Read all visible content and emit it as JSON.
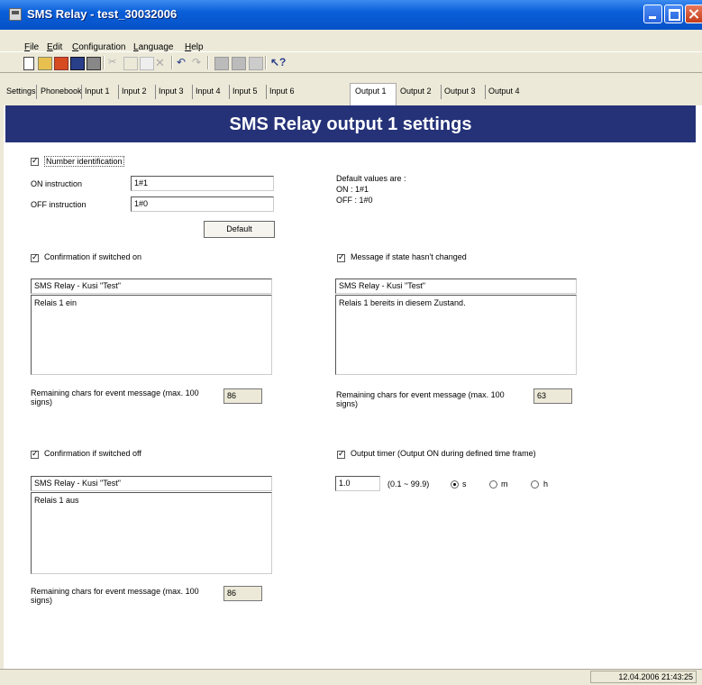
{
  "window": {
    "title": "SMS Relay - test_30032006"
  },
  "menu": [
    "File",
    "Edit",
    "Configuration",
    "Language",
    "Help"
  ],
  "toolbar": {
    "icons": [
      "new-icon",
      "open-icon",
      "open-folder-icon",
      "save-icon",
      "print-icon",
      "cut-icon",
      "copy-icon",
      "paste-icon",
      "delete-icon",
      "undo-icon",
      "redo-icon",
      "read-device-icon",
      "write-device-icon",
      "device-icon",
      "help-pointer-icon"
    ]
  },
  "tabs": [
    "Settings",
    "Phonebook",
    "Input 1",
    "Input 2",
    "Input 3",
    "Input 4",
    "Input 5",
    "Input 6",
    "Output 1",
    "Output 2",
    "Output 3",
    "Output 4"
  ],
  "active_tab": "Output 1",
  "header": {
    "title": "SMS Relay output 1 settings"
  },
  "number_identification": {
    "label": "Number identification",
    "checked": true,
    "on_label": "ON instruction",
    "on_value": "1#1",
    "off_label": "OFF instruction",
    "off_value": "1#0",
    "default_button": "Default"
  },
  "defaults_info": {
    "heading": "Default values are :",
    "on": "ON : 1#1",
    "off": "OFF : 1#0"
  },
  "confirm_on": {
    "label": "Confirmation if switched on",
    "checked": true,
    "sender": "SMS Relay - Kusi \"Test\"",
    "message": "Relais 1 ein",
    "remaining_label": "Remaining chars for event message (max. 100 signs)",
    "remaining_value": "86"
  },
  "unchanged": {
    "label": "Message if state hasn't changed",
    "checked": true,
    "sender": "SMS Relay - Kusi \"Test\"",
    "message": "Relais 1 bereits in diesem Zustand.",
    "remaining_label": "Remaining chars for event message (max. 100 signs)",
    "remaining_value": "63"
  },
  "confirm_off": {
    "label": "Confirmation if switched off",
    "checked": true,
    "sender": "SMS Relay - Kusi \"Test\"",
    "message": "Relais 1 aus",
    "remaining_label": "Remaining chars for event message (max. 100 signs)",
    "remaining_value": "86"
  },
  "timer": {
    "label": "Output timer (Output ON during defined time frame)",
    "checked": true,
    "value": "1.0",
    "range": "(0.1 ~ 99.9)",
    "units": [
      "s",
      "m",
      "h"
    ],
    "selected_unit": "s"
  },
  "status": {
    "datetime": "12.04.2006 21:43:25"
  }
}
